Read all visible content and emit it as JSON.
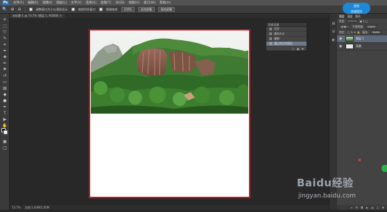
{
  "menubar": {
    "logo": "Ps",
    "items": [
      "文件(F)",
      "编辑(E)",
      "图像(I)",
      "图层(L)",
      "文字(Y)",
      "选择(S)",
      "滤镜(T)",
      "3D(D)",
      "视图(V)",
      "窗口(W)",
      "帮助(H)"
    ]
  },
  "optionsbar": {
    "zoom_label": "调整窗口大小以满屏显示",
    "check1_label": "缩放所有窗口",
    "check2_label": "细微缩放",
    "btn1": "100%",
    "btn2": "适合屏幕",
    "btn3": "填充屏幕"
  },
  "document_tab": "未标题-1 @ 73.7% (图层 1, RGB/8) ×",
  "history": {
    "title": "历史记录",
    "rows": [
      {
        "icon": "history-state-icon",
        "label": "打开"
      },
      {
        "icon": "history-state-icon",
        "label": "画布大小"
      },
      {
        "icon": "history-state-icon",
        "label": "复制"
      },
      {
        "icon": "history-state-icon",
        "label": "通过拷贝的图层"
      }
    ],
    "active_index": 3
  },
  "dock": {
    "tabs": [
      "图层",
      "通道",
      "路径"
    ],
    "kind_label": "类型",
    "blend_mode": "正常",
    "opacity_label": "不透明度:",
    "opacity": "100%",
    "lock_label": "锁定:",
    "fill_label": "填充:",
    "fill": "100%",
    "layers": [
      {
        "name": "图层 1",
        "type": "photo",
        "selected": true
      },
      {
        "name": "背景",
        "type": "white",
        "selected": false
      }
    ]
  },
  "statusbar": {
    "zoom": "73.7%",
    "doc_info": "文档:1.03M/2.05M"
  },
  "badge": {
    "text1": "经验",
    "text2": "快速提问"
  },
  "watermark": {
    "logo": "Baidu经验",
    "url": "jingyan.baidu.com"
  },
  "colors": {
    "document_border": "#c4161c",
    "selection": "#6c7a8c",
    "badge": "#1e88d6"
  }
}
